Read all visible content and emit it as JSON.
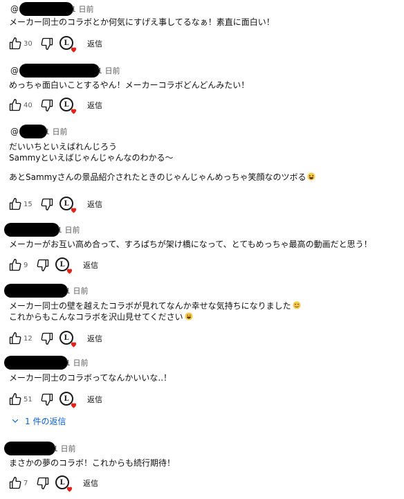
{
  "comments": [
    {
      "at": "@",
      "time": "1 日前",
      "lines": [
        "メーカー同士のコラボとか何気にすげえ事してるなぁ！素直に面白い！"
      ],
      "likes": "30",
      "reply_label": "返信"
    },
    {
      "at": "@",
      "time": "1 日前",
      "lines": [
        "めっちゃ面白いことするやん！メーカーコラボどんどんみたい！"
      ],
      "likes": "40",
      "reply_label": "返信"
    },
    {
      "at": "@",
      "time": "1 日前",
      "lines": [
        "だいいちといえばれんじろう",
        "Sammyといえばじゃんじゃんなのわかる〜",
        "",
        "あとSammyさんの景品紹介されたときのじゃんじゃんめっちゃ笑顔なのツボる"
      ],
      "likes": "15",
      "reply_label": "返信",
      "emoji": "grinning-squint-emoji"
    },
    {
      "at": "",
      "time": "1 日前",
      "lines": [
        "メーカーがお互い高め合って、すろぱちが架け橋になって、とてもめっちゃ最高の動画だと思う！"
      ],
      "likes": "9",
      "reply_label": "返信"
    },
    {
      "at": "",
      "time": "1 日前",
      "lines": [
        "メーカー同士の壁を越えたコラボが見れてなんか幸せな気持ちになりました",
        "これからもこんなコラボを沢山見せてください"
      ],
      "likes": "12",
      "reply_label": "返信",
      "emoji": "smiling-emoji"
    },
    {
      "at": "",
      "time": "1 日前",
      "lines": [
        "メーカー同士のコラボってなんかいいな..！"
      ],
      "likes": "51",
      "reply_label": "返信"
    },
    {
      "at": "",
      "time": "1 日前",
      "lines": [
        "まさかの夢のコラボ！これからも続行期待！"
      ],
      "likes": "7",
      "reply_label": "返信"
    }
  ],
  "replies_toggle": {
    "label": "1 件の返信",
    "icon": "chevron-down-icon",
    "color": "#065fd4"
  },
  "creator_heart": {
    "initial": "L",
    "heart_color": "#e62117"
  },
  "icons": {
    "like": "thumbs-up-icon",
    "dislike": "thumbs-down-icon"
  }
}
